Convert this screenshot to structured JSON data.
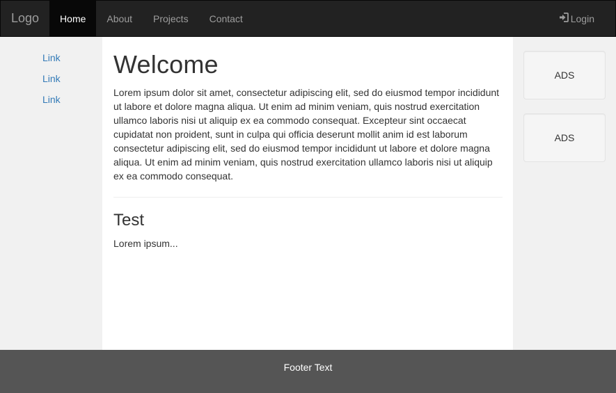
{
  "navbar": {
    "brand": "Logo",
    "items": [
      {
        "label": "Home",
        "active": true
      },
      {
        "label": "About",
        "active": false
      },
      {
        "label": "Projects",
        "active": false
      },
      {
        "label": "Contact",
        "active": false
      }
    ],
    "login_label": "Login",
    "login_icon": "log-in-icon"
  },
  "sidebar_left": {
    "links": [
      "Link",
      "Link",
      "Link"
    ]
  },
  "main": {
    "heading": "Welcome",
    "paragraph": "Lorem ipsum dolor sit amet, consectetur adipiscing elit, sed do eiusmod tempor incididunt ut labore et dolore magna aliqua. Ut enim ad minim veniam, quis nostrud exercitation ullamco laboris nisi ut aliquip ex ea commodo consequat. Excepteur sint occaecat cupidatat non proident, sunt in culpa qui officia deserunt mollit anim id est laborum consectetur adipiscing elit, sed do eiusmod tempor incididunt ut labore et dolore magna aliqua. Ut enim ad minim veniam, quis nostrud exercitation ullamco laboris nisi ut aliquip ex ea commodo consequat.",
    "subheading": "Test",
    "subparagraph": "Lorem ipsum..."
  },
  "sidebar_right": {
    "ads": [
      "ADS",
      "ADS"
    ]
  },
  "footer": {
    "text": "Footer Text"
  },
  "colors": {
    "navbar_bg": "#222222",
    "link": "#337ab7",
    "sidebar_bg": "#f1f1f1",
    "footer_bg": "#555555"
  }
}
